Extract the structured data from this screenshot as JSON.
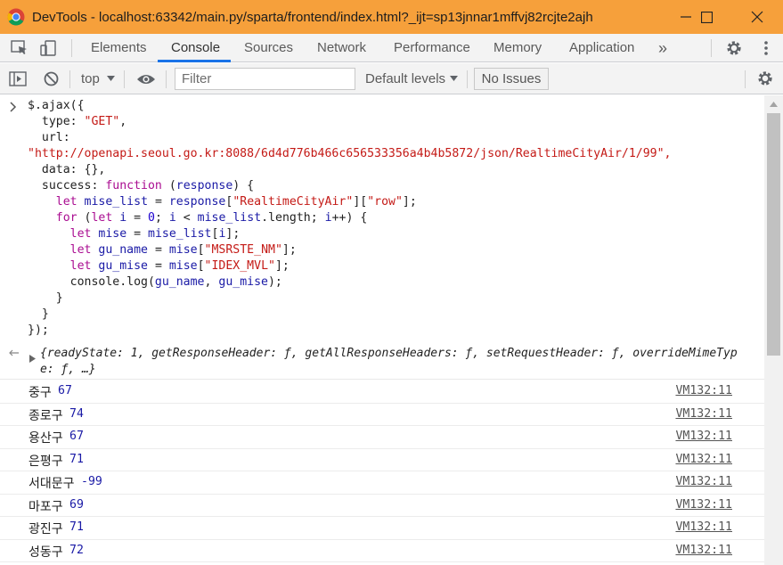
{
  "window": {
    "title": "DevTools - localhost:63342/main.py/sparta/frontend/index.html?_ijt=sp13jnnar1mffvj82rcjte2ajh"
  },
  "tabs": [
    {
      "label": "Elements"
    },
    {
      "label": "Console"
    },
    {
      "label": "Sources"
    },
    {
      "label": "Network"
    },
    {
      "label": "Performance"
    },
    {
      "label": "Memory"
    },
    {
      "label": "Application"
    }
  ],
  "more_tabs_label": "»",
  "console_toolbar": {
    "context": "top",
    "filter_placeholder": "Filter",
    "levels": "Default levels",
    "issues": "No Issues"
  },
  "code_lines": [
    "$.ajax({",
    "  type: \"GET\",",
    "  url:",
    "\"http://openapi.seoul.go.kr:8088/6d4d776b466c656533356a4b4b5872/json/RealtimeCityAir/1/99\",",
    "  data: {},",
    "  success: function (response) {",
    "    let mise_list = response[\"RealtimeCityAir\"][\"row\"];",
    "    for (let i = 0; i < mise_list.length; i++) {",
    "      let mise = mise_list[i];",
    "      let gu_name = mise[\"MSRSTE_NM\"];",
    "      let gu_mise = mise[\"IDEX_MVL\"];",
    "      console.log(gu_name, gu_mise);",
    "    }",
    "  }",
    "});"
  ],
  "result": {
    "text": "{readyState: 1, getResponseHeader: ƒ, getAllResponseHeaders: ƒ, setRequestHeader: ƒ, overrideMimeType: ƒ, …}"
  },
  "logs": [
    {
      "gu": "중구",
      "mise": "67",
      "source": "VM132:11"
    },
    {
      "gu": "종로구",
      "mise": "74",
      "source": "VM132:11"
    },
    {
      "gu": "용산구",
      "mise": "67",
      "source": "VM132:11"
    },
    {
      "gu": "은평구",
      "mise": "71",
      "source": "VM132:11"
    },
    {
      "gu": "서대문구",
      "mise": "-99",
      "source": "VM132:11"
    },
    {
      "gu": "마포구",
      "mise": "69",
      "source": "VM132:11"
    },
    {
      "gu": "광진구",
      "mise": "71",
      "source": "VM132:11"
    },
    {
      "gu": "성동구",
      "mise": "72",
      "source": "VM132:11"
    }
  ],
  "colors": {
    "titlebar": "#f6a03b",
    "active_tab_underline": "#1a73e8",
    "keyword": "#aa0d91",
    "string": "#c41a16",
    "number": "#1c00cf"
  }
}
